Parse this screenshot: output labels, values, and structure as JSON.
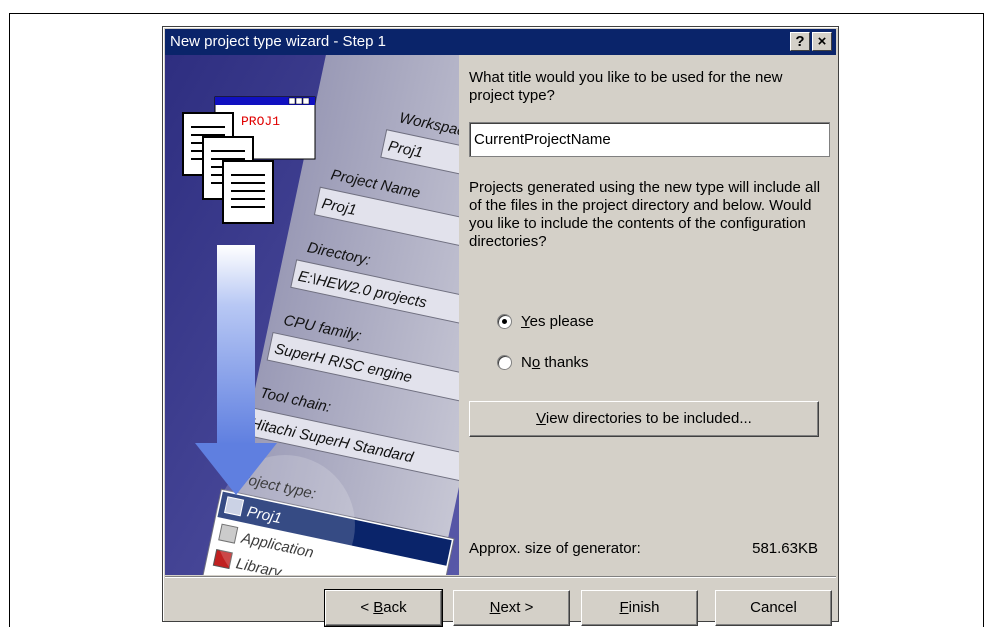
{
  "window": {
    "title": "New project type wizard - Step 1",
    "help_glyph": "?",
    "close_glyph": "×"
  },
  "illustration": {
    "doc_label": "PROJ1",
    "field_labels": [
      "Workspace",
      "Project Name",
      "Directory:",
      "CPU family:",
      "Tool chain:",
      "Project type:"
    ],
    "field_values": [
      "Proj1",
      "Proj1",
      "E:\\HEW2.0 projects",
      "SuperH RISC engine",
      "Hitachi SuperH Standard"
    ],
    "project_types": [
      "Proj1",
      "Application",
      "Library"
    ]
  },
  "content": {
    "question1": "What title would you like to be used for the new project type?",
    "title_value": "CurrentProjectName",
    "question2": "Projects generated using the new type will include all of the files in the project directory and below. Would you like to include the contents of the configuration directories?",
    "radio_yes": {
      "access": "Y",
      "rest": "es please",
      "selected": true
    },
    "radio_no": {
      "pre": "N",
      "access": "o",
      "rest": " thanks",
      "selected": false
    },
    "view_button": {
      "access": "V",
      "rest": "iew directories to be included..."
    },
    "size_label": "Approx. size of generator:",
    "size_value": "581.63KB"
  },
  "footer": {
    "back": {
      "pre": "< ",
      "access": "B",
      "rest": "ack"
    },
    "next": {
      "access": "N",
      "rest": "ext >"
    },
    "finish": {
      "access": "F",
      "rest": "inish"
    },
    "cancel": "Cancel"
  },
  "colors": {
    "titlebar": "#0a246a",
    "dialog_face": "#d4d0c8",
    "art_background": "#3a3a8e",
    "arrow": "#6f8fe8"
  }
}
